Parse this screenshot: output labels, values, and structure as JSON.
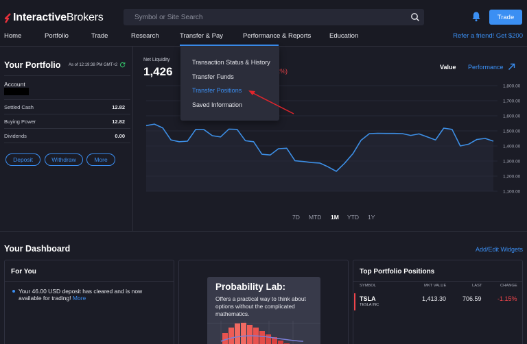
{
  "brand": {
    "name_bold": "Interactive",
    "name_regular": "Brokers"
  },
  "search": {
    "placeholder": "Symbol or Site Search"
  },
  "header": {
    "trade_label": "Trade",
    "refer_label": "Refer a friend! Get $200"
  },
  "nav": {
    "items": [
      "Home",
      "Portfolio",
      "Trade",
      "Research",
      "Transfer & Pay",
      "Performance & Reports",
      "Education"
    ],
    "active": "Transfer & Pay"
  },
  "dropdown": {
    "items": [
      "Transaction Status & History",
      "Transfer Funds",
      "Transfer Positions",
      "Saved Information"
    ],
    "highlighted": "Transfer Positions"
  },
  "portfolio": {
    "title": "Your Portfolio",
    "as_of": "As of 12:19:38 PM GMT+2",
    "account_label": "Account",
    "rows": [
      {
        "label": "Settled Cash",
        "value": "12.82"
      },
      {
        "label": "Buying Power",
        "value": "12.82"
      },
      {
        "label": "Dividends",
        "value": "0.00"
      }
    ],
    "buttons": [
      "Deposit",
      "Withdraw",
      "More"
    ]
  },
  "summary": {
    "net_liquidity_label": "Net Liquidity",
    "net_liquidity_value": "1,426",
    "partial_label": "0",
    "partial_change": "2%)",
    "toggle_value": "Value",
    "toggle_performance": "Performance"
  },
  "chart_data": {
    "type": "line",
    "yticks": [
      "1,800.00",
      "1,700.00",
      "1,600.00",
      "1,500.00",
      "1,400.00",
      "1,300.00",
      "1,200.00",
      "1,100.00"
    ],
    "ylim": [
      1100,
      1800
    ],
    "series": [
      {
        "values": [
          1535,
          1545,
          1520,
          1440,
          1428,
          1432,
          1510,
          1508,
          1468,
          1460,
          1512,
          1510,
          1435,
          1428,
          1345,
          1340,
          1382,
          1385,
          1302,
          1297,
          1290,
          1287,
          1262,
          1232,
          1285,
          1348,
          1438,
          1482,
          1484,
          1483,
          1483,
          1482,
          1470,
          1480,
          1460,
          1440,
          1518,
          1510,
          1400,
          1412,
          1443,
          1450,
          1432
        ]
      }
    ],
    "color": "#3d8fe6",
    "ranges": [
      "7D",
      "MTD",
      "1M",
      "YTD",
      "1Y"
    ],
    "active_range": "1M"
  },
  "dashboard": {
    "title": "Your Dashboard",
    "edit_label": "Add/Edit Widgets",
    "for_you": {
      "title": "For You",
      "message": "Your 46.00 USD deposit has cleared and is now available for trading!",
      "more": "More"
    },
    "probability_lab": {
      "title": "Probability Lab:",
      "description": "Offers a practical way to think about options without the complicated mathematics."
    },
    "top_positions": {
      "title": "Top Portfolio Positions",
      "headers": [
        "SYMBOL",
        "MKT VALUE",
        "LAST",
        "CHANGE"
      ],
      "rows": [
        {
          "symbol": "TSLA",
          "name": "TESLA INC",
          "mkt_value": "1,413.30",
          "last": "706.59",
          "change": "-1.15%"
        }
      ]
    }
  },
  "colors": {
    "accent": "#3b8ff3",
    "negative": "#f0454b",
    "background": "#1b1c26"
  }
}
